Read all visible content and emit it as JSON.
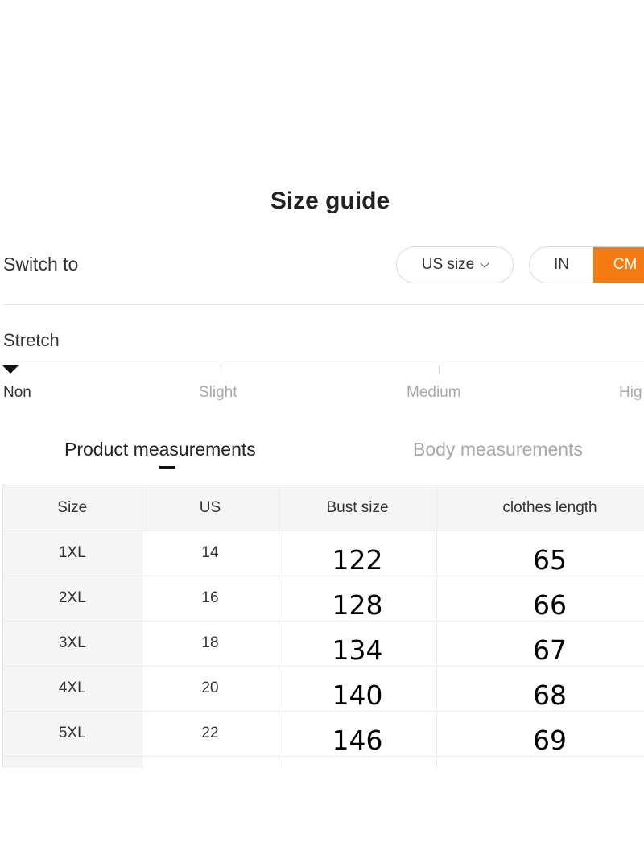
{
  "page_title": "Size guide",
  "switch": {
    "label": "Switch to",
    "size_system": "US size",
    "units": [
      {
        "label": "IN",
        "active": false
      },
      {
        "label": "CM",
        "active": true
      }
    ]
  },
  "stretch": {
    "label": "Stretch",
    "levels": [
      "Non",
      "Slight",
      "Medium",
      "Hig"
    ],
    "selected": "Non"
  },
  "tabs": [
    {
      "label": "Product measurements",
      "active": true
    },
    {
      "label": "Body measurements",
      "active": false
    }
  ],
  "table": {
    "headers": [
      "Size",
      "US",
      "Bust size",
      "clothes length"
    ],
    "rows": [
      [
        "1XL",
        "14",
        "122",
        "65"
      ],
      [
        "2XL",
        "16",
        "128",
        "66"
      ],
      [
        "3XL",
        "18",
        "134",
        "67"
      ],
      [
        "4XL",
        "20",
        "140",
        "68"
      ],
      [
        "5XL",
        "22",
        "146",
        "69"
      ]
    ]
  },
  "colors": {
    "accent": "#f57a12",
    "header_bg": "#f5f5f5",
    "muted_text": "#a8a8a8"
  },
  "icons": {
    "size_dropdown": "chevron-down-icon",
    "stretch_marker": "triangle-down-icon"
  }
}
